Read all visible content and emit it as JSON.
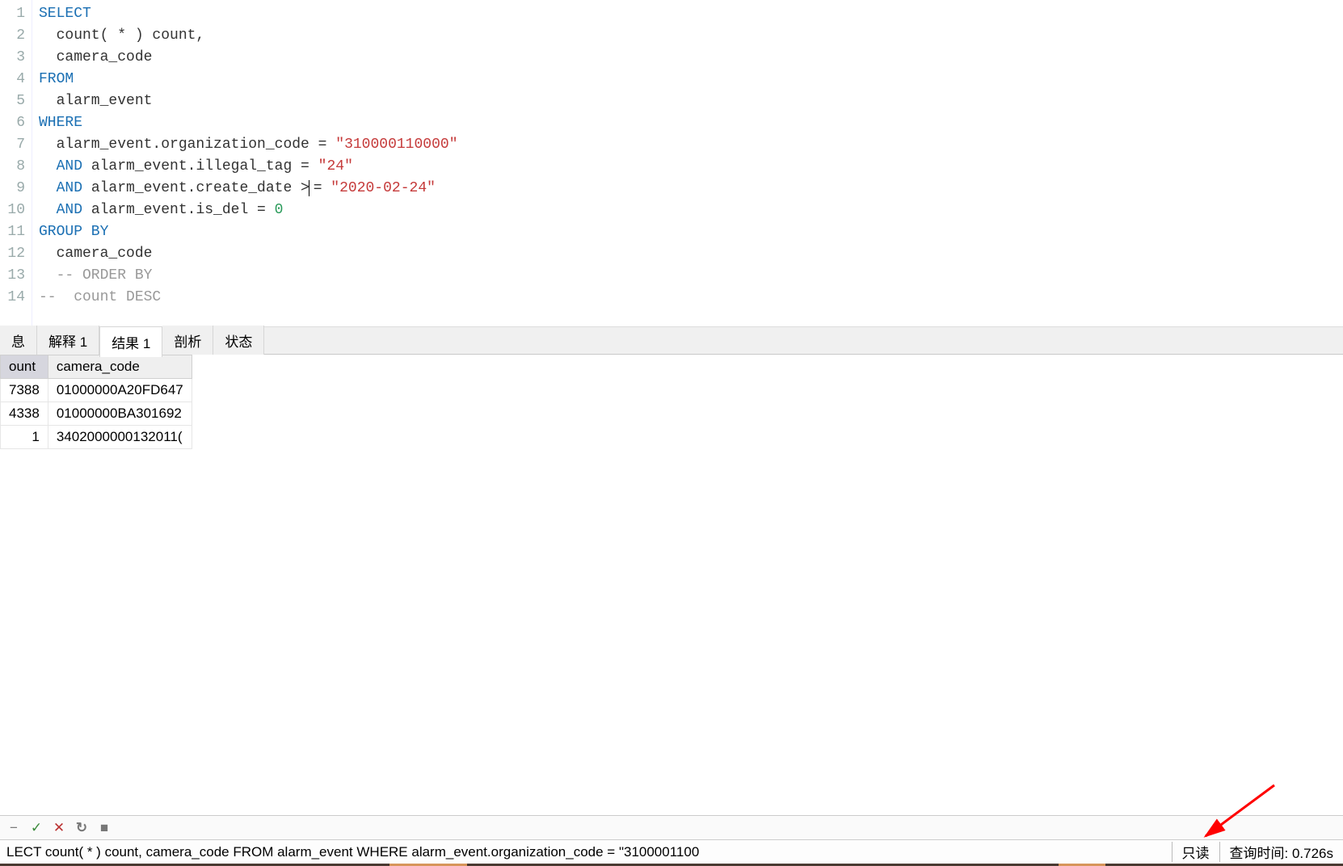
{
  "sql": {
    "lines": [
      {
        "n": 1,
        "tokens": [
          {
            "t": "SELECT",
            "c": "kw"
          }
        ]
      },
      {
        "n": 2,
        "tokens": [
          {
            "t": "  count( * ) count,",
            "c": ""
          }
        ]
      },
      {
        "n": 3,
        "tokens": [
          {
            "t": "  camera_code ",
            "c": ""
          }
        ]
      },
      {
        "n": 4,
        "tokens": [
          {
            "t": "FROM",
            "c": "kw"
          }
        ]
      },
      {
        "n": 5,
        "tokens": [
          {
            "t": "  alarm_event ",
            "c": ""
          }
        ]
      },
      {
        "n": 6,
        "tokens": [
          {
            "t": "WHERE",
            "c": "kw"
          }
        ]
      },
      {
        "n": 7,
        "tokens": [
          {
            "t": "  alarm_event.organization_code = ",
            "c": ""
          },
          {
            "t": "\"310000110000\"",
            "c": "str"
          },
          {
            "t": " ",
            "c": ""
          }
        ]
      },
      {
        "n": 8,
        "tokens": [
          {
            "t": "  ",
            "c": ""
          },
          {
            "t": "AND",
            "c": "kw"
          },
          {
            "t": " alarm_event.illegal_tag = ",
            "c": ""
          },
          {
            "t": "\"24\"",
            "c": "str"
          },
          {
            "t": " ",
            "c": ""
          }
        ]
      },
      {
        "n": 9,
        "tokens": [
          {
            "t": "  ",
            "c": ""
          },
          {
            "t": "AND",
            "c": "kw"
          },
          {
            "t": " alarm_event.create_date >",
            "c": ""
          },
          {
            "t": "",
            "c": "cursor"
          },
          {
            "t": "= ",
            "c": ""
          },
          {
            "t": "\"2020-02-24\"",
            "c": "str"
          },
          {
            "t": " ",
            "c": ""
          }
        ]
      },
      {
        "n": 10,
        "tokens": [
          {
            "t": "  ",
            "c": ""
          },
          {
            "t": "AND",
            "c": "kw"
          },
          {
            "t": " alarm_event.is_del = ",
            "c": ""
          },
          {
            "t": "0",
            "c": "num"
          },
          {
            "t": " ",
            "c": ""
          }
        ]
      },
      {
        "n": 11,
        "tokens": [
          {
            "t": "GROUP BY",
            "c": "kw"
          }
        ]
      },
      {
        "n": 12,
        "tokens": [
          {
            "t": "  camera_code ",
            "c": ""
          }
        ]
      },
      {
        "n": 13,
        "tokens": [
          {
            "t": "  -- ORDER BY",
            "c": "cmt"
          }
        ]
      },
      {
        "n": 14,
        "tokens": [
          {
            "t": "--  count DESC",
            "c": "cmt"
          }
        ]
      }
    ]
  },
  "tabs": {
    "items": [
      {
        "label": "息",
        "active": false
      },
      {
        "label": "解释 1",
        "active": false
      },
      {
        "label": "结果 1",
        "active": true
      },
      {
        "label": "剖析",
        "active": false
      },
      {
        "label": "状态",
        "active": false
      }
    ]
  },
  "result": {
    "headers": [
      "ount",
      "camera_code"
    ],
    "rows": [
      {
        "count": "7388",
        "camera_code": "01000000A20FD647"
      },
      {
        "count": "4338",
        "camera_code": "01000000BA301692"
      },
      {
        "count": "1",
        "camera_code": "3402000000132011("
      }
    ]
  },
  "status": {
    "sql_preview": "LECT    count( * ) count,        camera_code  FROM                alarm_event  WHERE                alarm_event.organization_code = \"3100001100",
    "readonly": "只读",
    "query_time": "查询时间: 0.726s"
  },
  "icons": {
    "dash": "−",
    "check": "✓",
    "close": "✕",
    "refresh": "↻",
    "stop": "■"
  }
}
